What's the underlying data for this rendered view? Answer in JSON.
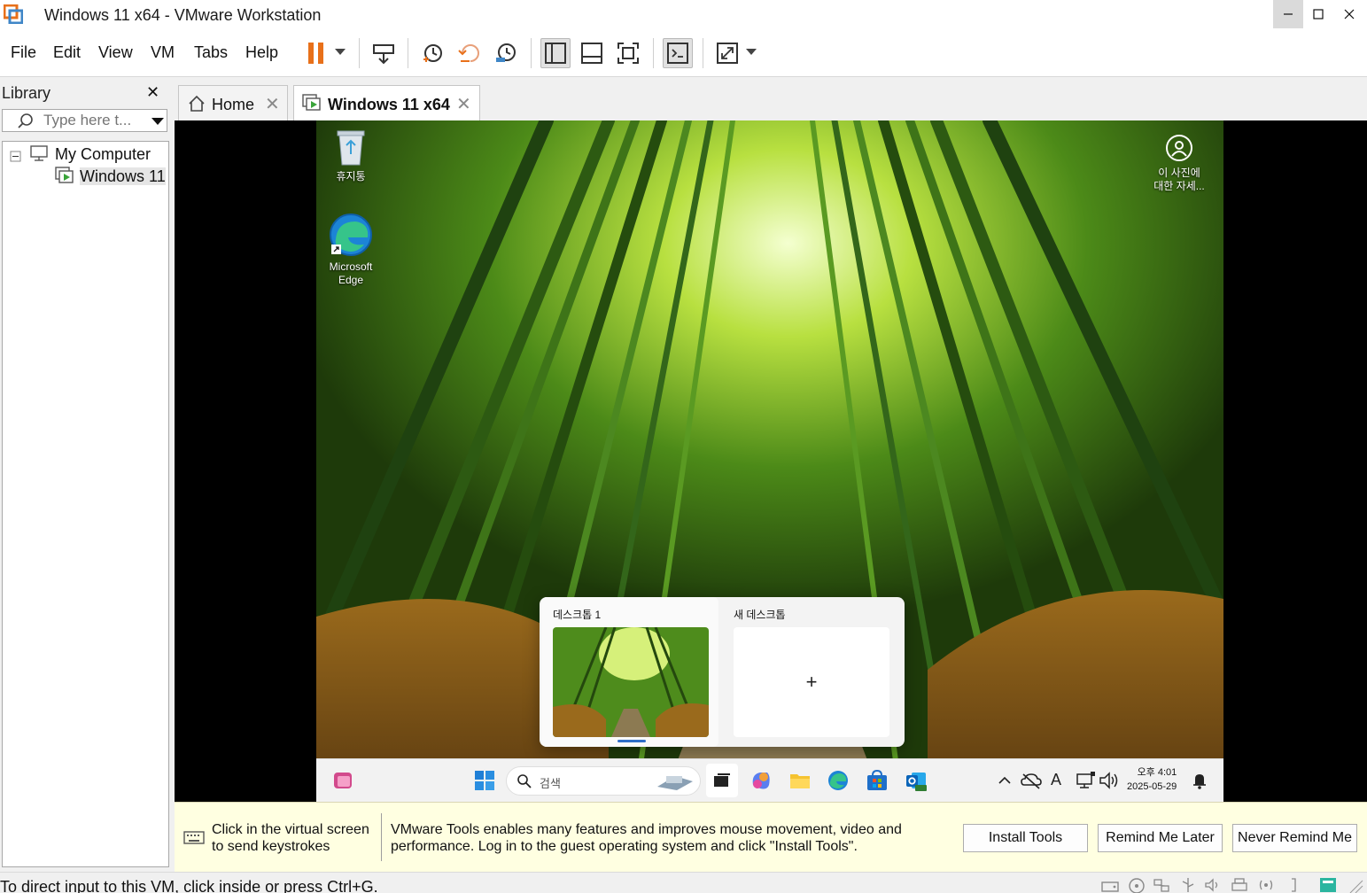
{
  "window": {
    "title": "Windows 11 x64 - VMware Workstation"
  },
  "menu": [
    "File",
    "Edit",
    "View",
    "VM",
    "Tabs",
    "Help"
  ],
  "library": {
    "title": "Library",
    "search_placeholder": "Type here t...",
    "tree": {
      "root": "My Computer",
      "child": "Windows 11"
    }
  },
  "tabs": [
    {
      "label": "Home",
      "active": false
    },
    {
      "label": "Windows 11 x64",
      "active": true
    }
  ],
  "guest": {
    "desktop_icons": [
      {
        "label": "휴지통",
        "icon": "recycle-bin-icon"
      },
      {
        "label_line1": "Microsoft",
        "label_line2": "Edge",
        "icon": "edge-icon"
      }
    ],
    "spotlight": {
      "line1": "이 사진에",
      "line2": "대한 자세..."
    },
    "taskview": {
      "desktop1": "데스크톱 1",
      "new_desktop": "새 데스크톱",
      "add": "+"
    },
    "taskbar": {
      "search_text": "검색",
      "ime": "A",
      "time": "오후 4:01",
      "date": "2025-05-29"
    }
  },
  "notification": {
    "hint": "Click in the virtual screen to send keystrokes",
    "message": "VMware Tools enables many features and improves mouse movement, video and performance. Log in to the guest operating system and click \"Install Tools\".",
    "buttons": {
      "install": "Install Tools",
      "remind": "Remind Me Later",
      "never": "Never Remind Me"
    }
  },
  "status": {
    "text": "To direct input to this VM, click inside or press Ctrl+G."
  },
  "colors": {
    "accent_orange": "#e8701a",
    "notif_bg": "#ffffe1",
    "vm_green": "#3aa43a"
  }
}
